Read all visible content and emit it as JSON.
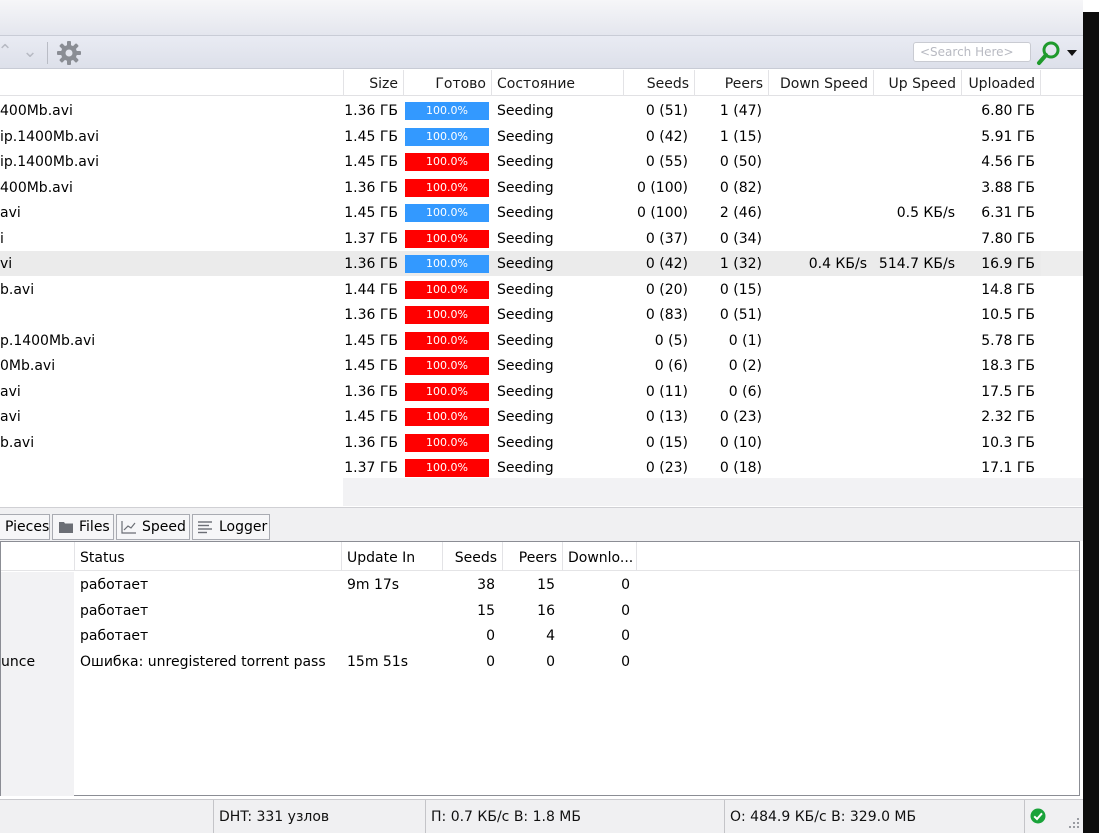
{
  "toolbar": {
    "search_placeholder": "<Search Here>"
  },
  "list": {
    "columns": [
      "Size",
      "Готово",
      "Состояние",
      "Seeds",
      "Peers",
      "Down Speed",
      "Up Speed",
      "Uploaded"
    ],
    "rows": [
      {
        "name": "400Mb.avi",
        "size": "1.36 ГБ",
        "done": "100.0%",
        "status": "Seeding",
        "seeds": "0 (51)",
        "peers": "1 (47)",
        "down": "",
        "up": "",
        "uploaded": "6.80 ГБ",
        "bar_color": "#3399ff"
      },
      {
        "name": "ip.1400Mb.avi",
        "size": "1.45 ГБ",
        "done": "100.0%",
        "status": "Seeding",
        "seeds": "0 (42)",
        "peers": "1 (15)",
        "down": "",
        "up": "",
        "uploaded": "5.91 ГБ",
        "bar_color": "#3399ff"
      },
      {
        "name": "ip.1400Mb.avi",
        "size": "1.45 ГБ",
        "done": "100.0%",
        "status": "Seeding",
        "seeds": "0 (55)",
        "peers": "0 (50)",
        "down": "",
        "up": "",
        "uploaded": "4.56 ГБ",
        "bar_color": "#ff0000"
      },
      {
        "name": "400Mb.avi",
        "size": "1.36 ГБ",
        "done": "100.0%",
        "status": "Seeding",
        "seeds": "0 (100)",
        "peers": "0 (82)",
        "down": "",
        "up": "",
        "uploaded": "3.88 ГБ",
        "bar_color": "#ff0000"
      },
      {
        "name": "avi",
        "size": "1.45 ГБ",
        "done": "100.0%",
        "status": "Seeding",
        "seeds": "0 (100)",
        "peers": "2 (46)",
        "down": "",
        "up": "0.5 КБ/s",
        "uploaded": "6.31 ГБ",
        "bar_color": "#3399ff"
      },
      {
        "name": "i",
        "size": "1.37 ГБ",
        "done": "100.0%",
        "status": "Seeding",
        "seeds": "0 (37)",
        "peers": "0 (34)",
        "down": "",
        "up": "",
        "uploaded": "7.80 ГБ",
        "bar_color": "#ff0000"
      },
      {
        "name": "vi",
        "size": "1.36 ГБ",
        "done": "100.0%",
        "status": "Seeding",
        "seeds": "0 (42)",
        "peers": "1 (32)",
        "down": "0.4 КБ/s",
        "up": "514.7 КБ/s",
        "uploaded": "16.9 ГБ",
        "bar_color": "#3399ff"
      },
      {
        "name": "b.avi",
        "size": "1.44 ГБ",
        "done": "100.0%",
        "status": "Seeding",
        "seeds": "0 (20)",
        "peers": "0 (15)",
        "down": "",
        "up": "",
        "uploaded": "14.8 ГБ",
        "bar_color": "#ff0000"
      },
      {
        "name": "",
        "size": "1.36 ГБ",
        "done": "100.0%",
        "status": "Seeding",
        "seeds": "0 (83)",
        "peers": "0 (51)",
        "down": "",
        "up": "",
        "uploaded": "10.5 ГБ",
        "bar_color": "#ff0000"
      },
      {
        "name": "p.1400Mb.avi",
        "size": "1.45 ГБ",
        "done": "100.0%",
        "status": "Seeding",
        "seeds": "0 (5)",
        "peers": "0 (1)",
        "down": "",
        "up": "",
        "uploaded": "5.78 ГБ",
        "bar_color": "#ff0000"
      },
      {
        "name": "0Mb.avi",
        "size": "1.45 ГБ",
        "done": "100.0%",
        "status": "Seeding",
        "seeds": "0 (6)",
        "peers": "0 (2)",
        "down": "",
        "up": "",
        "uploaded": "18.3 ГБ",
        "bar_color": "#ff0000"
      },
      {
        "name": "avi",
        "size": "1.36 ГБ",
        "done": "100.0%",
        "status": "Seeding",
        "seeds": "0 (11)",
        "peers": "0 (6)",
        "down": "",
        "up": "",
        "uploaded": "17.5 ГБ",
        "bar_color": "#ff0000"
      },
      {
        "name": "avi",
        "size": "1.45 ГБ",
        "done": "100.0%",
        "status": "Seeding",
        "seeds": "0 (13)",
        "peers": "0 (23)",
        "down": "",
        "up": "",
        "uploaded": "2.32 ГБ",
        "bar_color": "#ff0000"
      },
      {
        "name": "b.avi",
        "size": "1.36 ГБ",
        "done": "100.0%",
        "status": "Seeding",
        "seeds": "0 (15)",
        "peers": "0 (10)",
        "down": "",
        "up": "",
        "uploaded": "10.3 ГБ",
        "bar_color": "#ff0000"
      },
      {
        "name": "",
        "size": "1.37 ГБ",
        "done": "100.0%",
        "status": "Seeding",
        "seeds": "0 (23)",
        "peers": "0 (18)",
        "down": "",
        "up": "",
        "uploaded": "17.1 ГБ",
        "bar_color": "#ff0000"
      }
    ]
  },
  "tabs": {
    "pieces": "Pieces",
    "files": "Files",
    "speed": "Speed",
    "logger": "Logger"
  },
  "trackers": {
    "columns": [
      "Status",
      "Update In",
      "Seeds",
      "Peers",
      "Downlo..."
    ],
    "rows": [
      {
        "name": "",
        "status": "работает",
        "update_in": "9m 17s",
        "seeds": "38",
        "peers": "15",
        "downloaded": "0"
      },
      {
        "name": "",
        "status": "работает",
        "update_in": "",
        "seeds": "15",
        "peers": "16",
        "downloaded": "0"
      },
      {
        "name": "",
        "status": "работает",
        "update_in": "",
        "seeds": "0",
        "peers": "4",
        "downloaded": "0"
      },
      {
        "name": "unce",
        "status": "Ошибка: unregistered torrent pass",
        "update_in": "15m 51s",
        "seeds": "0",
        "peers": "0",
        "downloaded": "0"
      }
    ]
  },
  "statusbar": {
    "dht": "DHT: 331 узлов",
    "download": "П: 0.7 КБ/с В: 1.8 МБ",
    "upload": "О: 484.9 КБ/с В: 329.0 МБ"
  },
  "colors": {
    "bar_blue": "#3399ff",
    "bar_red": "#ff0000",
    "status_ok": "#1aa33a",
    "search_green": "#1f9a2c"
  }
}
